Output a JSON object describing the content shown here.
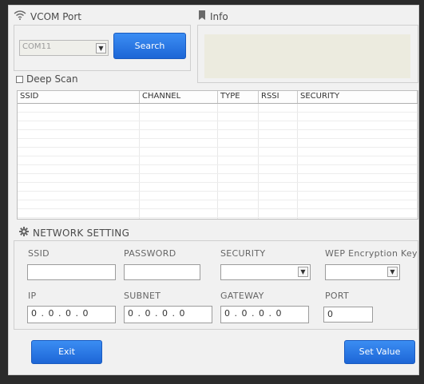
{
  "vcom": {
    "title": "VCOM Port",
    "port_value": "COM11",
    "search_label": "Search",
    "deep_scan_label": "Deep Scan",
    "deep_scan_checked": false
  },
  "info": {
    "title": "Info"
  },
  "scan_table": {
    "columns": [
      "SSID",
      "CHANNEL",
      "TYPE",
      "RSSI",
      "SECURITY"
    ],
    "rows": []
  },
  "network": {
    "title": "NETWORK SETTING",
    "ssid_label": "SSID",
    "ssid_value": "",
    "password_label": "PASSWORD",
    "password_value": "",
    "security_label": "SECURITY",
    "security_value": "",
    "wep_label": "WEP Encryption Key",
    "wep_value": "",
    "ip_label": "IP",
    "ip_value": "0 . 0 . 0 . 0",
    "subnet_label": "SUBNET",
    "subnet_value": "0 . 0 . 0 . 0",
    "gateway_label": "GATEWAY",
    "gateway_value": "0 . 0 . 0 . 0",
    "port_label": "PORT",
    "port_value": "0"
  },
  "footer": {
    "exit_label": "Exit",
    "set_value_label": "Set Value"
  },
  "colors": {
    "button_blue": "#1d66d6",
    "info_area": "#ecebdf",
    "background": "#f1f1f1"
  },
  "icons": [
    "wifi-icon",
    "info-bookmark-icon",
    "gear-icon",
    "chevron-down-icon"
  ]
}
